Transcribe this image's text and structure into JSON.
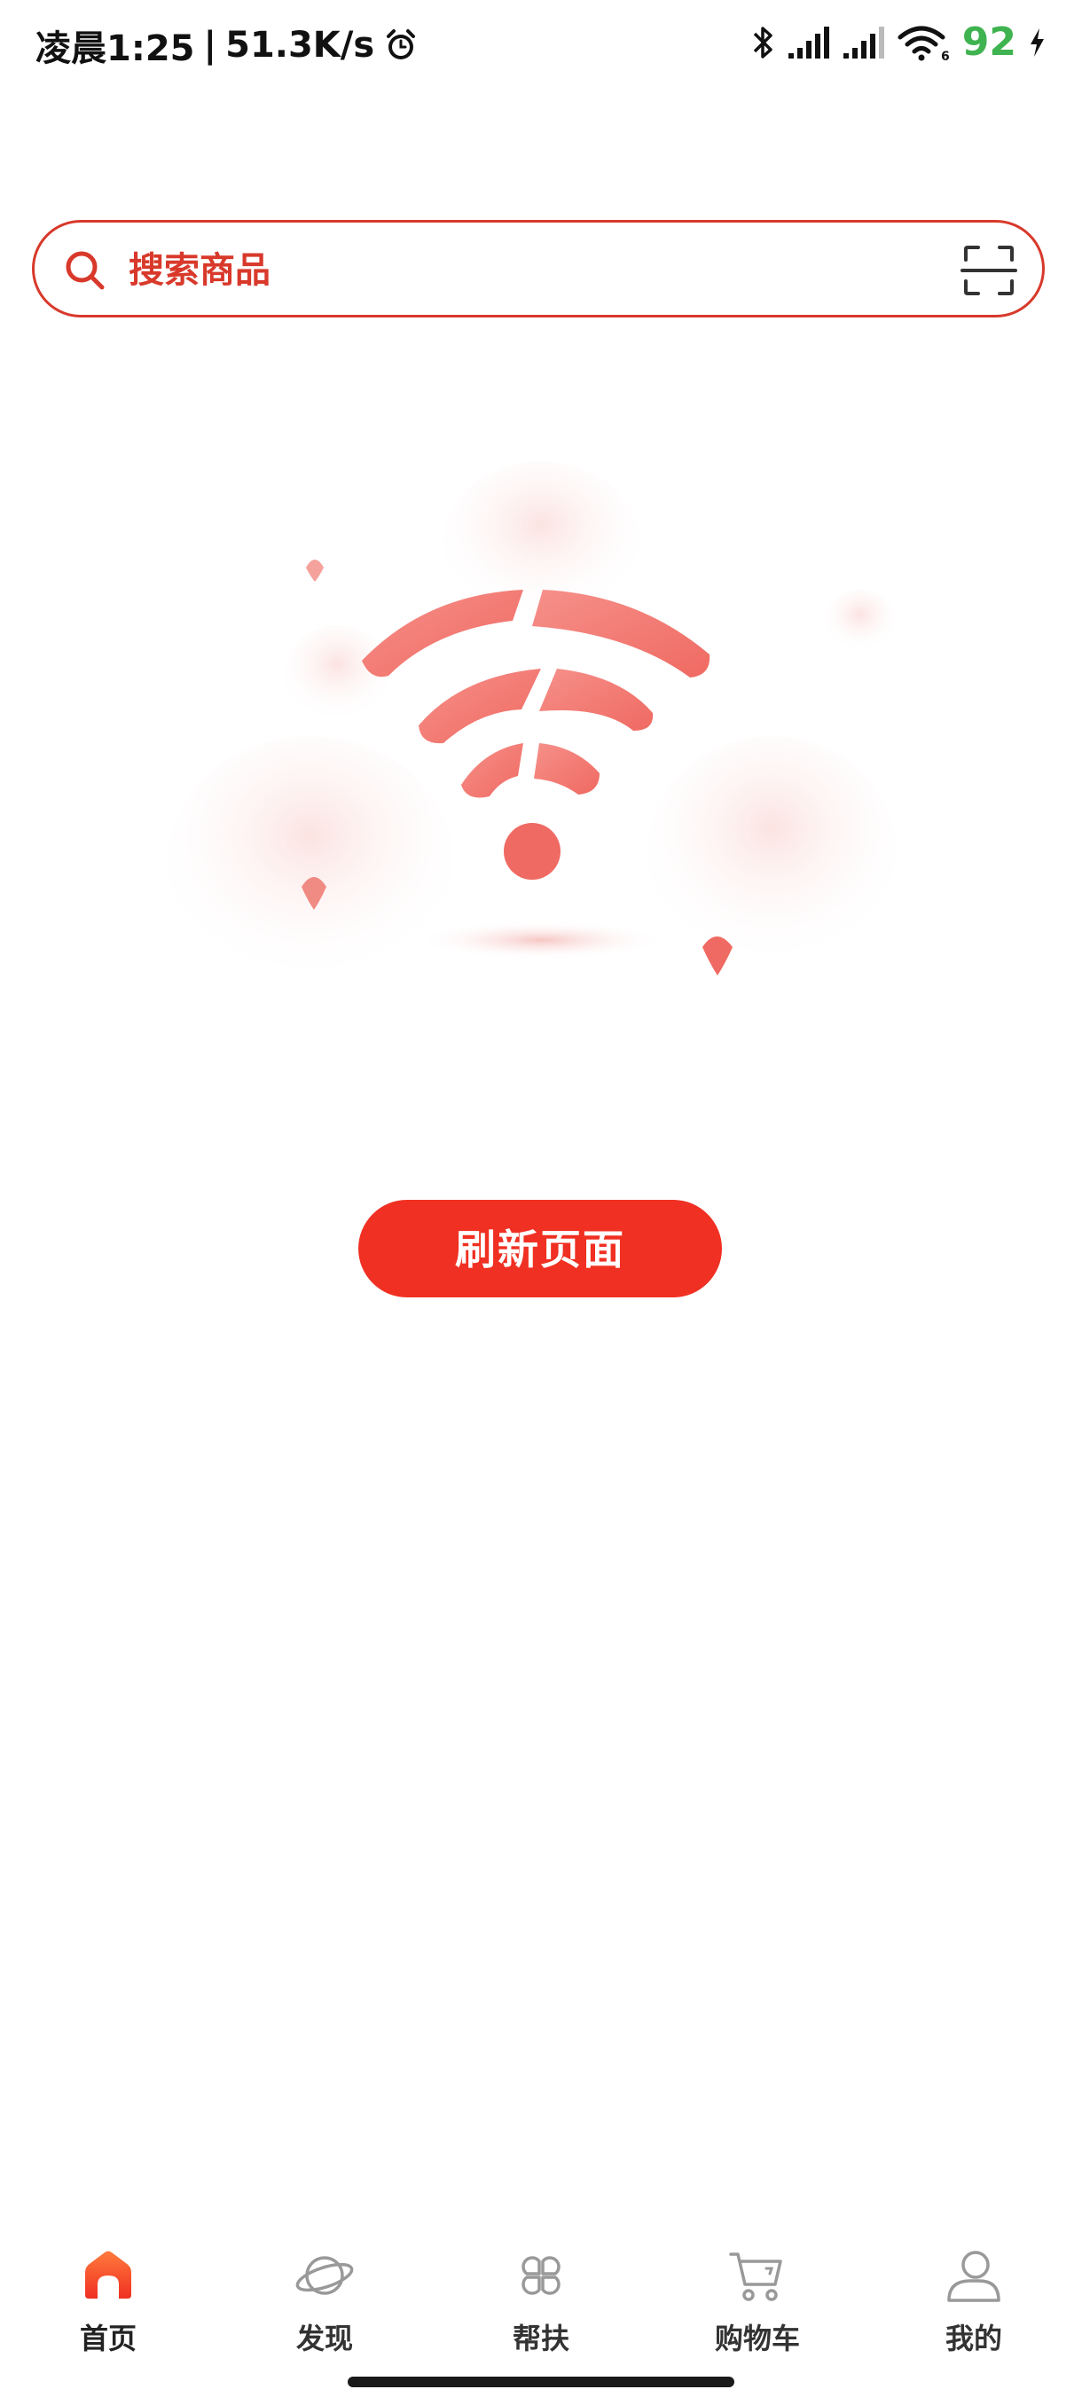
{
  "status_bar": {
    "time": "凌晨1:25",
    "separator": "|",
    "network_speed": "51.3K/s",
    "battery": "92",
    "battery_color": "#3fb34f",
    "icons": [
      "alarm-icon",
      "bluetooth-icon",
      "signal-icon",
      "signal-icon",
      "wifi-icon",
      "charging-icon"
    ]
  },
  "search": {
    "placeholder": "搜索商品",
    "accent_color": "#d8392b",
    "left_icon": "search-icon",
    "right_icon": "scan-icon"
  },
  "main": {
    "illustration": "no-network-wifi-illustration",
    "refresh_label": "刷新页面",
    "button_color": "#f03022"
  },
  "bottom_nav": {
    "items": [
      {
        "label": "首页",
        "icon": "home-icon",
        "active": true
      },
      {
        "label": "发现",
        "icon": "planet-icon",
        "active": false
      },
      {
        "label": "帮扶",
        "icon": "clover-icon",
        "active": false
      },
      {
        "label": "购物车",
        "icon": "cart-icon",
        "active": false
      },
      {
        "label": "我的",
        "icon": "user-icon",
        "active": false
      }
    ]
  }
}
